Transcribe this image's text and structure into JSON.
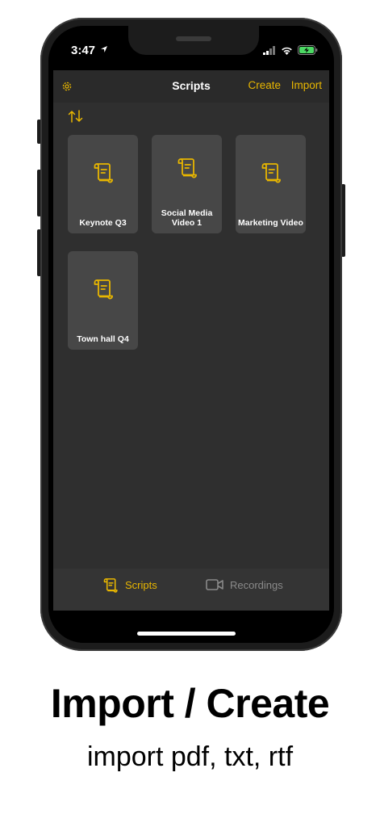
{
  "status_bar": {
    "time": "3:47"
  },
  "nav": {
    "title": "Scripts",
    "create_label": "Create",
    "import_label": "Import"
  },
  "scripts": [
    {
      "title": "Keynote Q3"
    },
    {
      "title": "Social Media Video 1"
    },
    {
      "title": "Marketing Video"
    },
    {
      "title": "Town hall Q4"
    }
  ],
  "tabs": [
    {
      "label": "Scripts",
      "icon": "script-icon",
      "selected": true
    },
    {
      "label": "Recordings",
      "icon": "video-camera-icon",
      "selected": false
    }
  ],
  "caption": {
    "title": "Import / Create",
    "subtitle": "import pdf, txt, rtf"
  },
  "colors": {
    "accent": "#e8b600",
    "background": "#2f2f2f",
    "card": "#474747"
  }
}
